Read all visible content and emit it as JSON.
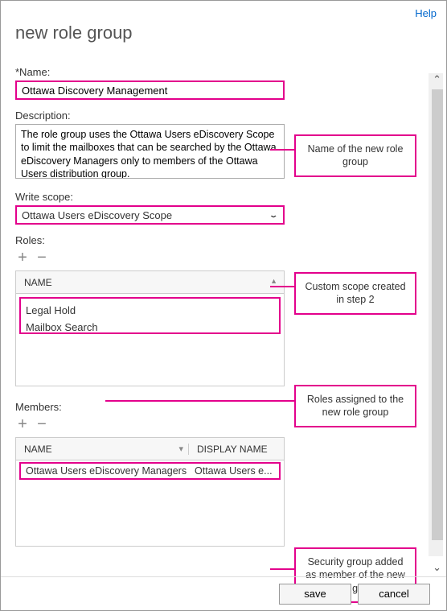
{
  "header": {
    "help": "Help",
    "title": "new role group"
  },
  "form": {
    "name_label": "*Name:",
    "name_value": "Ottawa Discovery Management",
    "desc_label": "Description:",
    "desc_value": "The role group uses the Ottawa Users eDiscovery Scope to limit the mailboxes that can be searched by the Ottawa eDiscovery Managers only to members of the Ottawa Users distribution group.",
    "scope_label": "Write scope:",
    "scope_value": "Ottawa Users eDiscovery Scope",
    "roles_label": "Roles:",
    "members_label": "Members:"
  },
  "tables": {
    "name_col": "NAME",
    "display_col": "DISPLAY NAME",
    "roles": [
      "Legal Hold",
      "Mailbox Search"
    ],
    "members": [
      {
        "name": "Ottawa Users eDiscovery Managers",
        "display": "Ottawa Users e..."
      }
    ]
  },
  "callouts": {
    "c1": "Name of the new role group",
    "c2": "Custom scope created in step 2",
    "c3": "Roles assigned to the new role group",
    "c4": "Security group added as member of the new role group"
  },
  "buttons": {
    "save": "save",
    "cancel": "cancel"
  },
  "icons": {
    "plus": "+",
    "minus": "−",
    "chevron": "⌄"
  }
}
